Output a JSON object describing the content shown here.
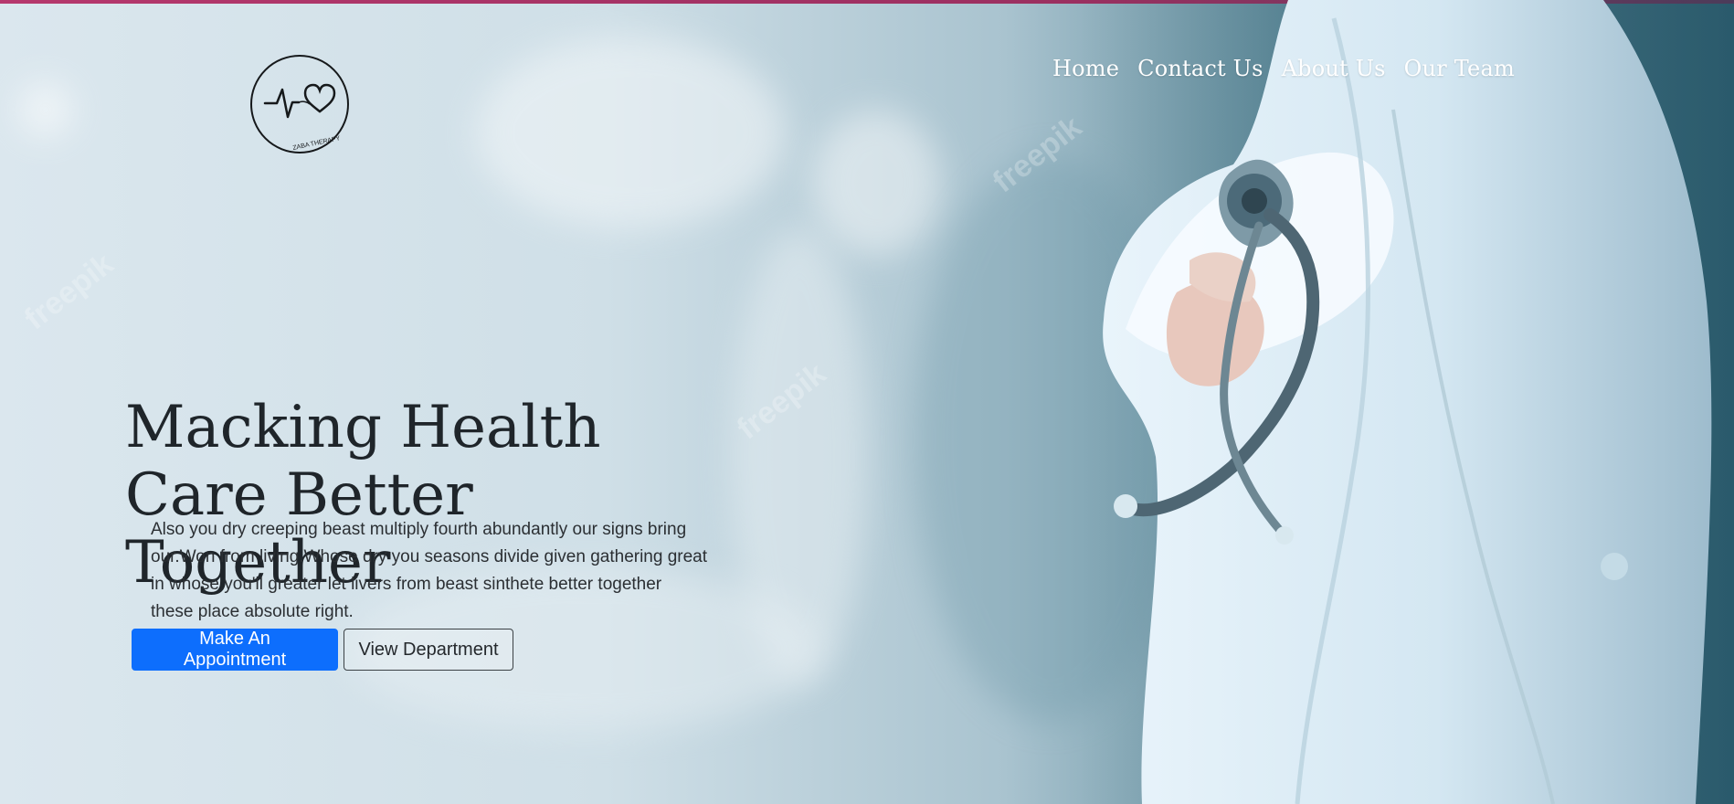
{
  "brand": {
    "logo_text": "ZABA THERAPY"
  },
  "nav": {
    "items": [
      {
        "label": "Home"
      },
      {
        "label": "Contact Us"
      },
      {
        "label": "About Us"
      },
      {
        "label": "Our Team"
      }
    ]
  },
  "hero": {
    "title_line_1": "Macking Health",
    "title_line_2": "Care Better Together",
    "description": "Also you dry creeping beast multiply fourth abundantly our signs bring our.Won from living.Whose dry you seasons divide given gathering great in whose you'll greater let livers from beast sinthete better together these place absolute right.",
    "primary_button": "Make An Appointment",
    "secondary_button": "View Department"
  },
  "watermarks": [
    "freepik",
    "freepik",
    "freepik",
    "freepik",
    "freepik",
    "freepik"
  ],
  "colors": {
    "accent": "#0d6efd",
    "top_bar": "#b6386d",
    "text_dark": "#1f252a"
  },
  "icons": {
    "logo": "heart-pulse-icon"
  }
}
